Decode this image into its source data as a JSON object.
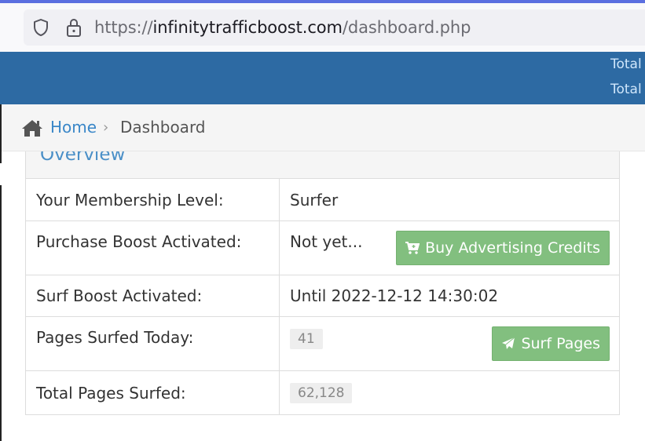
{
  "browser": {
    "url_prefix": "https://",
    "url_host": "infinitytrafficboost.com",
    "url_path": "/dashboard.php"
  },
  "header": {
    "total_line_1": "Total",
    "total_line_2": "Total"
  },
  "breadcrumb": {
    "home": "Home",
    "separator": "›",
    "current": "Dashboard"
  },
  "panel": {
    "title": "Overview",
    "rows": [
      {
        "label": "Your Membership Level:",
        "value": "Surfer"
      },
      {
        "label": "Purchase Boost Activated:",
        "value": "Not yet...",
        "button": "Buy Advertising Credits"
      },
      {
        "label": "Surf Boost Activated:",
        "value": "Until 2022-12-12 14:30:02"
      },
      {
        "label": "Pages Surfed Today:",
        "value": "41",
        "button": "Surf Pages"
      },
      {
        "label": "Total Pages Surfed:",
        "value": "62,128"
      }
    ]
  },
  "colors": {
    "header_blue": "#2d6aa3",
    "link_blue": "#3a87c8",
    "button_green": "#82bf7f"
  },
  "icons": {
    "shield": "shield-icon",
    "lock": "lock-icon",
    "home": "home-icon",
    "cart": "cart-icon",
    "send": "paper-plane-icon"
  }
}
